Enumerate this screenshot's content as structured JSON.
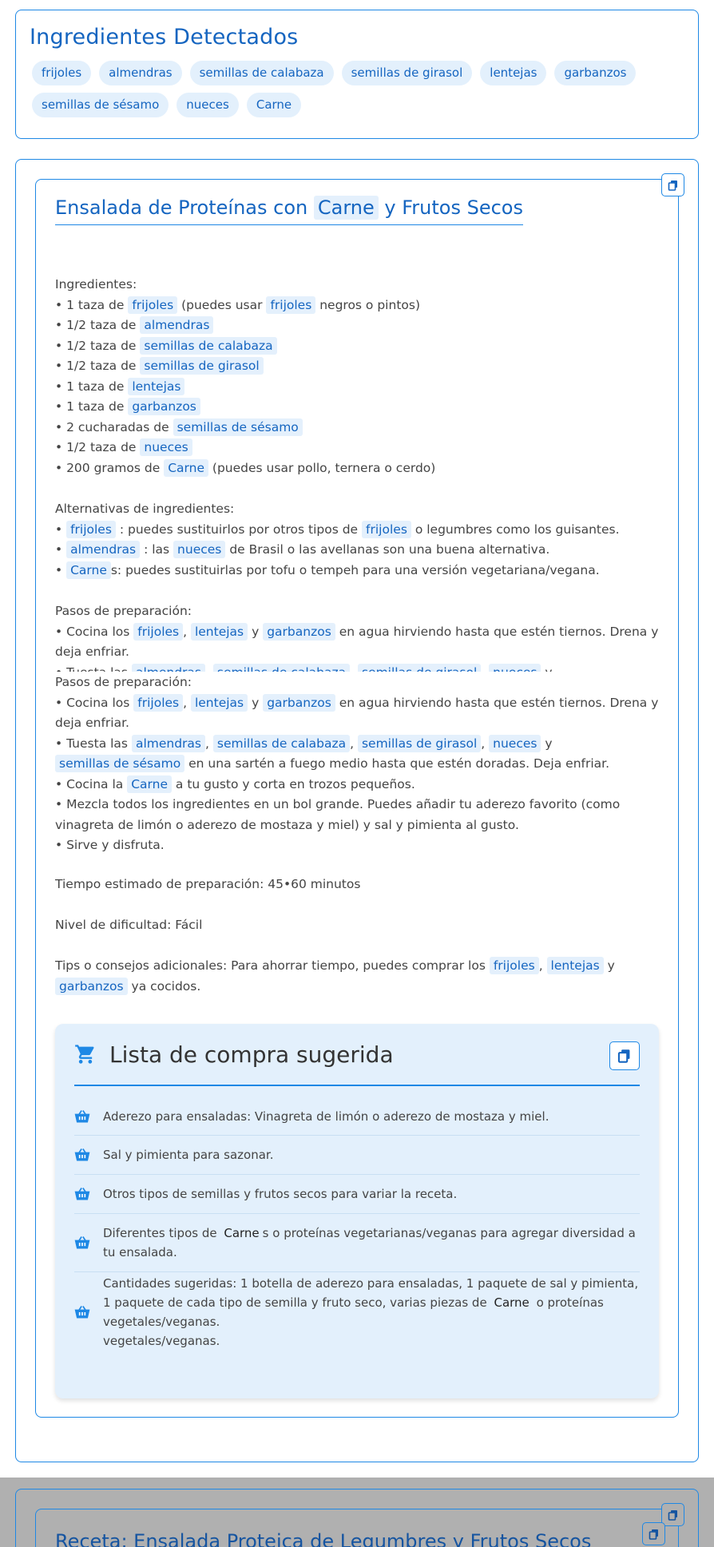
{
  "detected": {
    "title": "Ingredientes Detectados",
    "chips": [
      "frijoles",
      "almendras",
      "semillas de calabaza",
      "semillas de girasol",
      "lentejas",
      "garbanzos",
      "semillas de sésamo",
      "nueces",
      "Carne"
    ]
  },
  "recipe": {
    "title_pre": "Ensalada de Proteínas con",
    "title_hl": "Carne",
    "title_post": "y Frutos Secos",
    "ingredients_heading": "Ingredientes:",
    "ingredients": [
      {
        "pre": "• 1 taza de",
        "hl": "frijoles",
        "post": "(puedes usar",
        "hl2": "frijoles",
        "post2": "negros o pintos)"
      },
      {
        "pre": "• 1/2 taza de",
        "hl": "almendras"
      },
      {
        "pre": "• 1/2 taza de",
        "hl": "semillas de calabaza"
      },
      {
        "pre": "• 1/2 taza de",
        "hl": "semillas de girasol"
      },
      {
        "pre": "• 1 taza de",
        "hl": "lentejas"
      },
      {
        "pre": "• 1 taza de",
        "hl": "garbanzos"
      },
      {
        "pre": "• 2 cucharadas de",
        "hl": "semillas de sésamo"
      },
      {
        "pre": "• 1/2 taza de",
        "hl": "nueces"
      },
      {
        "pre": "• 200 gramos de",
        "hl": "Carne",
        "post": "(puedes usar pollo, ternera o cerdo)"
      }
    ],
    "alternatives_heading": "Alternativas de ingredientes:",
    "alt1": {
      "hl": "frijoles",
      "mid": ": puedes sustituirlos por otros tipos de",
      "hl2": "frijoles",
      "post": "o legumbres como los guisantes."
    },
    "alt2": {
      "hl": "almendras",
      "mid": ": las",
      "hl2": "nueces",
      "post": "de Brasil o las avellanas son una buena alternativa."
    },
    "alt3": {
      "hl": "Carne",
      "post": "s: puedes sustituirlas por tofu o tempeh para una versión vegetariana/vegana."
    },
    "steps_heading": "Pasos de preparación:",
    "step1": {
      "pre": "• Cocina los",
      "a": "frijoles",
      "b": "lentejas",
      "y": "y",
      "c": "garbanzos",
      "post": "en agua hirviendo hasta que estén tiernos. Drena y deja enfriar."
    },
    "step2": {
      "pre": "• Tuesta las",
      "a": "almendras",
      "b": "semillas de calabaza",
      "c": "semillas de girasol",
      "d": "nueces",
      "y": "y",
      "e": "semillas de sésamo",
      "post": "en una sartén a fuego medio hasta que estén doradas. Deja enfriar."
    },
    "step3": {
      "pre": "• Cocina la",
      "hl": "Carne",
      "post": "a tu gusto y corta en trozos pequeños."
    },
    "step4": "• Mezcla todos los ingredientes en un bol grande. Puedes añadir tu aderezo favorito (como vinagreta de limón o aderezo de mostaza y miel) y sal y pimienta al gusto.",
    "step5": "• Sirve y disfruta.",
    "time": "Tiempo estimado de preparación: 45•60 minutos",
    "difficulty": "Nivel de dificultad: Fácil",
    "tips": {
      "pre": "Tips o consejos adicionales: Para ahorrar tiempo, puedes comprar los",
      "a": "frijoles",
      "b": "lentejas",
      "y": "y",
      "c": "garbanzos",
      "post": "ya cocidos."
    }
  },
  "shopping": {
    "title": "Lista de compra sugerida",
    "items": [
      {
        "text": "Aderezo para ensaladas: Vinagreta de limón o aderezo de mostaza y miel."
      },
      {
        "text": "Sal y pimienta para sazonar."
      },
      {
        "text": "Otros tipos de semillas y frutos secos para variar la receta."
      },
      {
        "pre": "Diferentes tipos de",
        "hl": "Carne",
        "post": "s o proteínas vegetarianas/veganas para agregar diversidad a tu ensalada."
      },
      {
        "pre": "Cantidades sugeridas: 1 botella de aderezo para ensaladas, 1 paquete de sal y pimienta, 1 paquete de cada tipo de semilla y fruto seco, varias piezas de",
        "hl": "Carne",
        "post": "o proteínas vegetales/veganas.",
        "extra": "vegetales/veganas."
      }
    ]
  },
  "next_recipe": {
    "title": "Receta: Ensalada Proteica de Legumbres y Frutos Secos"
  },
  "colors": {
    "accent": "#1e88e5",
    "highlight_bg": "#e4f0fc",
    "highlight_text": "#1565c0",
    "overlay": "#b0b0b0"
  }
}
